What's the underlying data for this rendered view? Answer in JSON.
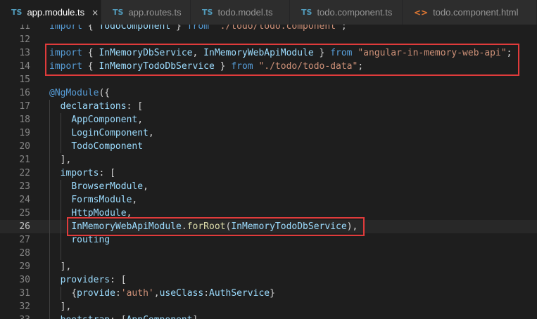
{
  "tabs": [
    {
      "icon": "TS",
      "label": "app.module.ts",
      "close": "×"
    },
    {
      "icon": "TS",
      "label": "app.routes.ts"
    },
    {
      "icon": "TS",
      "label": "todo.model.ts"
    },
    {
      "icon": "TS",
      "label": "todo.component.ts"
    },
    {
      "icon": "<>",
      "label": "todo.component.html"
    }
  ],
  "lines": [
    {
      "num": "11",
      "indent": 0,
      "tokens": [
        {
          "t": "import",
          "c": "kw"
        },
        {
          "t": " { ",
          "c": "pn"
        },
        {
          "t": "TodoComponent",
          "c": "id"
        },
        {
          "t": " } ",
          "c": "pn"
        },
        {
          "t": "from",
          "c": "kw"
        },
        {
          "t": " ",
          "c": "pn"
        },
        {
          "t": "\"./todo/todo.component\"",
          "c": "str"
        },
        {
          "t": ";",
          "c": "pn"
        }
      ]
    },
    {
      "num": "12",
      "indent": 0,
      "tokens": []
    },
    {
      "num": "13",
      "indent": 0,
      "tokens": [
        {
          "t": "import",
          "c": "kw"
        },
        {
          "t": " { ",
          "c": "pn"
        },
        {
          "t": "InMemoryDbService",
          "c": "id"
        },
        {
          "t": ", ",
          "c": "pn"
        },
        {
          "t": "InMemoryWebApiModule",
          "c": "id"
        },
        {
          "t": " } ",
          "c": "pn"
        },
        {
          "t": "from",
          "c": "kw"
        },
        {
          "t": " ",
          "c": "pn"
        },
        {
          "t": "\"angular-in-memory-web-api\"",
          "c": "str"
        },
        {
          "t": ";",
          "c": "pn"
        }
      ]
    },
    {
      "num": "14",
      "indent": 0,
      "tokens": [
        {
          "t": "import",
          "c": "kw"
        },
        {
          "t": " { ",
          "c": "pn"
        },
        {
          "t": "InMemoryTodoDbService",
          "c": "id"
        },
        {
          "t": " } ",
          "c": "pn"
        },
        {
          "t": "from",
          "c": "kw"
        },
        {
          "t": " ",
          "c": "pn"
        },
        {
          "t": "\"./todo/todo-data\"",
          "c": "str"
        },
        {
          "t": ";",
          "c": "pn"
        }
      ]
    },
    {
      "num": "15",
      "indent": 0,
      "tokens": []
    },
    {
      "num": "16",
      "indent": 0,
      "tokens": [
        {
          "t": "@NgModule",
          "c": "dc"
        },
        {
          "t": "({",
          "c": "pn"
        }
      ]
    },
    {
      "num": "17",
      "indent": 1,
      "tokens": [
        {
          "t": "declarations",
          "c": "id"
        },
        {
          "t": ": [",
          "c": "pn"
        }
      ]
    },
    {
      "num": "18",
      "indent": 2,
      "tokens": [
        {
          "t": "AppComponent",
          "c": "id"
        },
        {
          "t": ",",
          "c": "pn"
        }
      ]
    },
    {
      "num": "19",
      "indent": 2,
      "tokens": [
        {
          "t": "LoginComponent",
          "c": "id"
        },
        {
          "t": ",",
          "c": "pn"
        }
      ]
    },
    {
      "num": "20",
      "indent": 2,
      "tokens": [
        {
          "t": "TodoComponent",
          "c": "id"
        }
      ]
    },
    {
      "num": "21",
      "indent": 1,
      "tokens": [
        {
          "t": "],",
          "c": "pn"
        }
      ]
    },
    {
      "num": "22",
      "indent": 1,
      "tokens": [
        {
          "t": "imports",
          "c": "id"
        },
        {
          "t": ": [",
          "c": "pn"
        }
      ]
    },
    {
      "num": "23",
      "indent": 2,
      "tokens": [
        {
          "t": "BrowserModule",
          "c": "id"
        },
        {
          "t": ",",
          "c": "pn"
        }
      ]
    },
    {
      "num": "24",
      "indent": 2,
      "tokens": [
        {
          "t": "FormsModule",
          "c": "id"
        },
        {
          "t": ",",
          "c": "pn"
        }
      ]
    },
    {
      "num": "25",
      "indent": 2,
      "tokens": [
        {
          "t": "HttpModule",
          "c": "id"
        },
        {
          "t": ",",
          "c": "pn"
        }
      ]
    },
    {
      "num": "26",
      "indent": 2,
      "current": true,
      "tokens": [
        {
          "t": "InMemoryWebApiModule",
          "c": "id"
        },
        {
          "t": ".",
          "c": "pn"
        },
        {
          "t": "forRoot",
          "c": "fn"
        },
        {
          "t": "(",
          "c": "pn"
        },
        {
          "t": "InMemoryTodoDbService",
          "c": "id"
        },
        {
          "t": "),",
          "c": "pn"
        }
      ]
    },
    {
      "num": "27",
      "indent": 2,
      "tokens": [
        {
          "t": "routing",
          "c": "id"
        }
      ]
    },
    {
      "num": "28",
      "indent": 2,
      "tokens": []
    },
    {
      "num": "29",
      "indent": 1,
      "tokens": [
        {
          "t": "],",
          "c": "pn"
        }
      ]
    },
    {
      "num": "30",
      "indent": 1,
      "tokens": [
        {
          "t": "providers",
          "c": "id"
        },
        {
          "t": ": [",
          "c": "pn"
        }
      ]
    },
    {
      "num": "31",
      "indent": 2,
      "tokens": [
        {
          "t": "{",
          "c": "pn"
        },
        {
          "t": "provide",
          "c": "id"
        },
        {
          "t": ":",
          "c": "pn"
        },
        {
          "t": "'auth'",
          "c": "str"
        },
        {
          "t": ",",
          "c": "pn"
        },
        {
          "t": "useClass",
          "c": "id"
        },
        {
          "t": ":",
          "c": "pn"
        },
        {
          "t": "AuthService",
          "c": "id"
        },
        {
          "t": "}",
          "c": "pn"
        }
      ]
    },
    {
      "num": "32",
      "indent": 1,
      "tokens": [
        {
          "t": "],",
          "c": "pn"
        }
      ]
    },
    {
      "num": "33",
      "indent": 1,
      "tokens": [
        {
          "t": "bootstrap",
          "c": "id"
        },
        {
          "t": ": [",
          "c": "pn"
        },
        {
          "t": "AppComponent",
          "c": "id"
        },
        {
          "t": "]",
          "c": "pn"
        }
      ]
    }
  ],
  "highlights": [
    {
      "label": "highlight-imports",
      "from_line": "13",
      "to_line": "14"
    },
    {
      "label": "highlight-forroot",
      "from_line": "26",
      "to_line": "26"
    }
  ],
  "colors": {
    "background": "#1e1e1e",
    "keyword": "#569cd6",
    "identifier": "#9cdcfe",
    "string": "#ce9178",
    "function": "#dcdcaa",
    "highlight_border": "#e03b3b"
  }
}
